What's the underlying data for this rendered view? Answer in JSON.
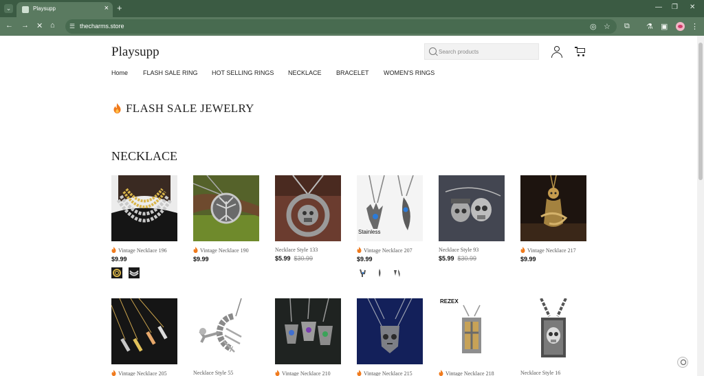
{
  "browser": {
    "tab_title": "Playsupp",
    "url": "thecharms.store"
  },
  "header": {
    "logo": "Playsupp",
    "search_placeholder": "Search products"
  },
  "nav": {
    "items": [
      "Home",
      "FLASH SALE RING",
      "HOT SELLING RINGS",
      "NECKLACE",
      "BRACELET",
      "WOMEN'S RINGS"
    ]
  },
  "flash_title": "FLASH SALE JEWELRY",
  "section_title": "NECKLACE",
  "colors": {
    "accent_fire": "#f07a1c",
    "tab_bar": "#3b5b43",
    "toolbar": "#5a7a60"
  },
  "products": [
    {
      "name": "Vintage Necklace 196",
      "fire": true,
      "price": "$9.99",
      "old_price": ""
    },
    {
      "name": "Vintage Necklace 190",
      "fire": true,
      "price": "$9.99",
      "old_price": ""
    },
    {
      "name": "Necklace Style 133",
      "fire": false,
      "price": "$5.99",
      "old_price": "$30.99"
    },
    {
      "name": "Vintage Necklace 207",
      "fire": true,
      "price": "$9.99",
      "old_price": "",
      "image_text": "Stainless"
    },
    {
      "name": "Necklace Style 93",
      "fire": false,
      "price": "$5.99",
      "old_price": "$30.99"
    },
    {
      "name": "Vintage Necklace 217",
      "fire": true,
      "price": "$9.99",
      "old_price": ""
    },
    {
      "name": "Vintage Necklace 205",
      "fire": true
    },
    {
      "name": "Necklace Style 55",
      "fire": false
    },
    {
      "name": "Vintage Necklace 210",
      "fire": true
    },
    {
      "name": "Vintage Necklace 215",
      "fire": true
    },
    {
      "name": "Vintage Necklace 218",
      "fire": true,
      "image_text": "REZEX"
    },
    {
      "name": "Necklace Style 16",
      "fire": false
    }
  ]
}
